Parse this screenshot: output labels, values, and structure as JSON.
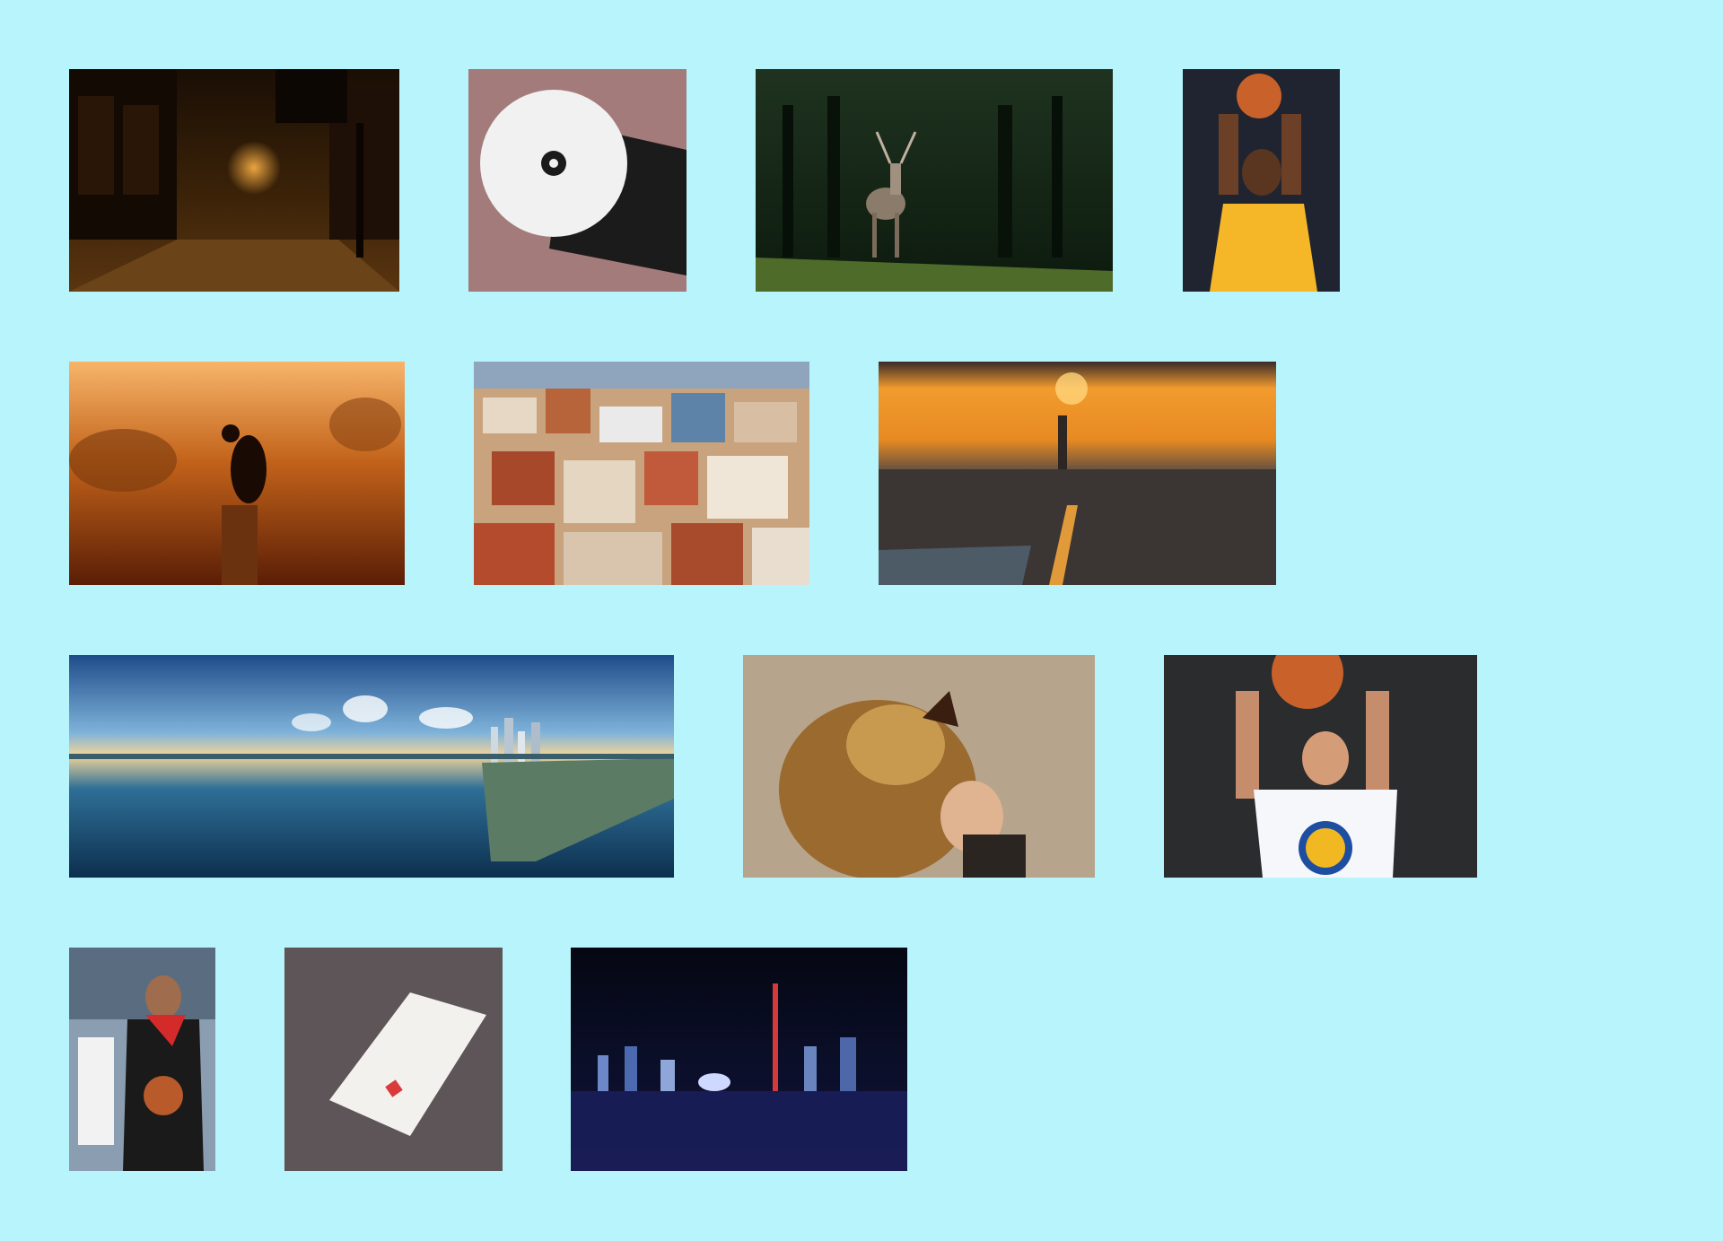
{
  "page": {
    "background_color": "#b7f4fb"
  },
  "gallery": {
    "images": [
      {
        "subject": "night-street"
      },
      {
        "subject": "disc-envelope-mockup"
      },
      {
        "subject": "deer-forest"
      },
      {
        "subject": "basketball-player-lakers"
      },
      {
        "subject": "crow-sunset"
      },
      {
        "subject": "city-rooftops"
      },
      {
        "subject": "city-sunset"
      },
      {
        "subject": "panorama-bay"
      },
      {
        "subject": "lion-child"
      },
      {
        "subject": "basketball-player-warriors"
      },
      {
        "subject": "basketball-player-portrait"
      },
      {
        "subject": "paper-mockup"
      },
      {
        "subject": "city-skyline-night"
      }
    ]
  }
}
